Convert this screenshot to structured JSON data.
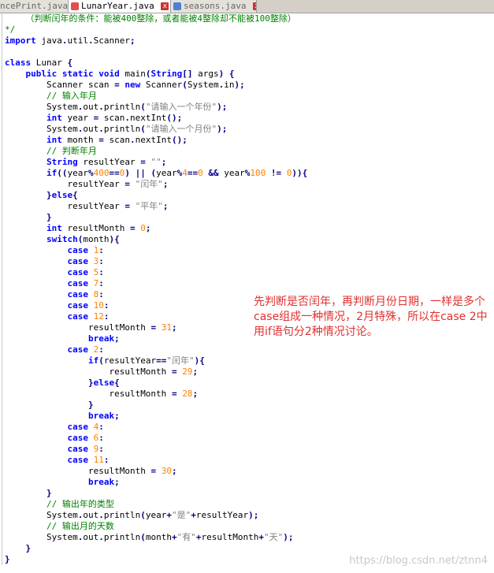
{
  "tabs": [
    {
      "label": "ncePrint.java",
      "active": false,
      "icon": "java-file-icon"
    },
    {
      "label": "LunarYear.java",
      "active": true,
      "icon": "java-file-icon"
    },
    {
      "label": "seasons.java",
      "active": false,
      "icon": "java-file-icon"
    }
  ],
  "code": [
    "    （判断闰年的条件：能被400整除，或者能被4整除却不能被100整除）",
    "*/",
    "import java.util.Scanner;",
    "",
    "class Lunar {",
    "    public static void main(String[] args) {",
    "        Scanner scan = new Scanner(System.in);",
    "        // 输入年月",
    "        System.out.println(\"请输入一个年份\");",
    "        int year = scan.nextInt();",
    "        System.out.println(\"请输入一个月份\");",
    "        int month = scan.nextInt();",
    "        // 判断年月",
    "        String resultYear = \"\";",
    "        if((year%400==0) || (year%4==0 && year%100 != 0)){",
    "            resultYear = \"闰年\";",
    "        }else{",
    "            resultYear = \"平年\";",
    "        }",
    "        int resultMonth = 0;",
    "        switch(month){",
    "            case 1:",
    "            case 3:",
    "            case 5:",
    "            case 7:",
    "            case 8:",
    "            case 10:",
    "            case 12:",
    "                resultMonth = 31;",
    "                break;",
    "            case 2:",
    "                if(resultYear==\"闰年\"){",
    "                    resultMonth = 29;",
    "                }else{",
    "                    resultMonth = 28;",
    "                }",
    "                break;",
    "            case 4:",
    "            case 6:",
    "            case 9:",
    "            case 11:",
    "                resultMonth = 30;",
    "                break;",
    "        }",
    "        // 输出年的类型",
    "        System.out.println(year+\"是\"+resultYear);",
    "        // 输出月的天数",
    "        System.out.println(month+\"有\"+resultMonth+\"天\");",
    "    }",
    "}"
  ],
  "annotation": "先判断是否闰年，再判断月份日期，一样是多个case组成一种情况，2月特殊，所以在case 2中用if语句分2种情况讨论。",
  "watermark": "https://blog.csdn.net/ztnn4",
  "colors": {
    "keyword": "#0000ff",
    "type": "#8000ff",
    "comment": "#008000",
    "string": "#808080",
    "number": "#ff8000",
    "annotation": "#e03030"
  }
}
